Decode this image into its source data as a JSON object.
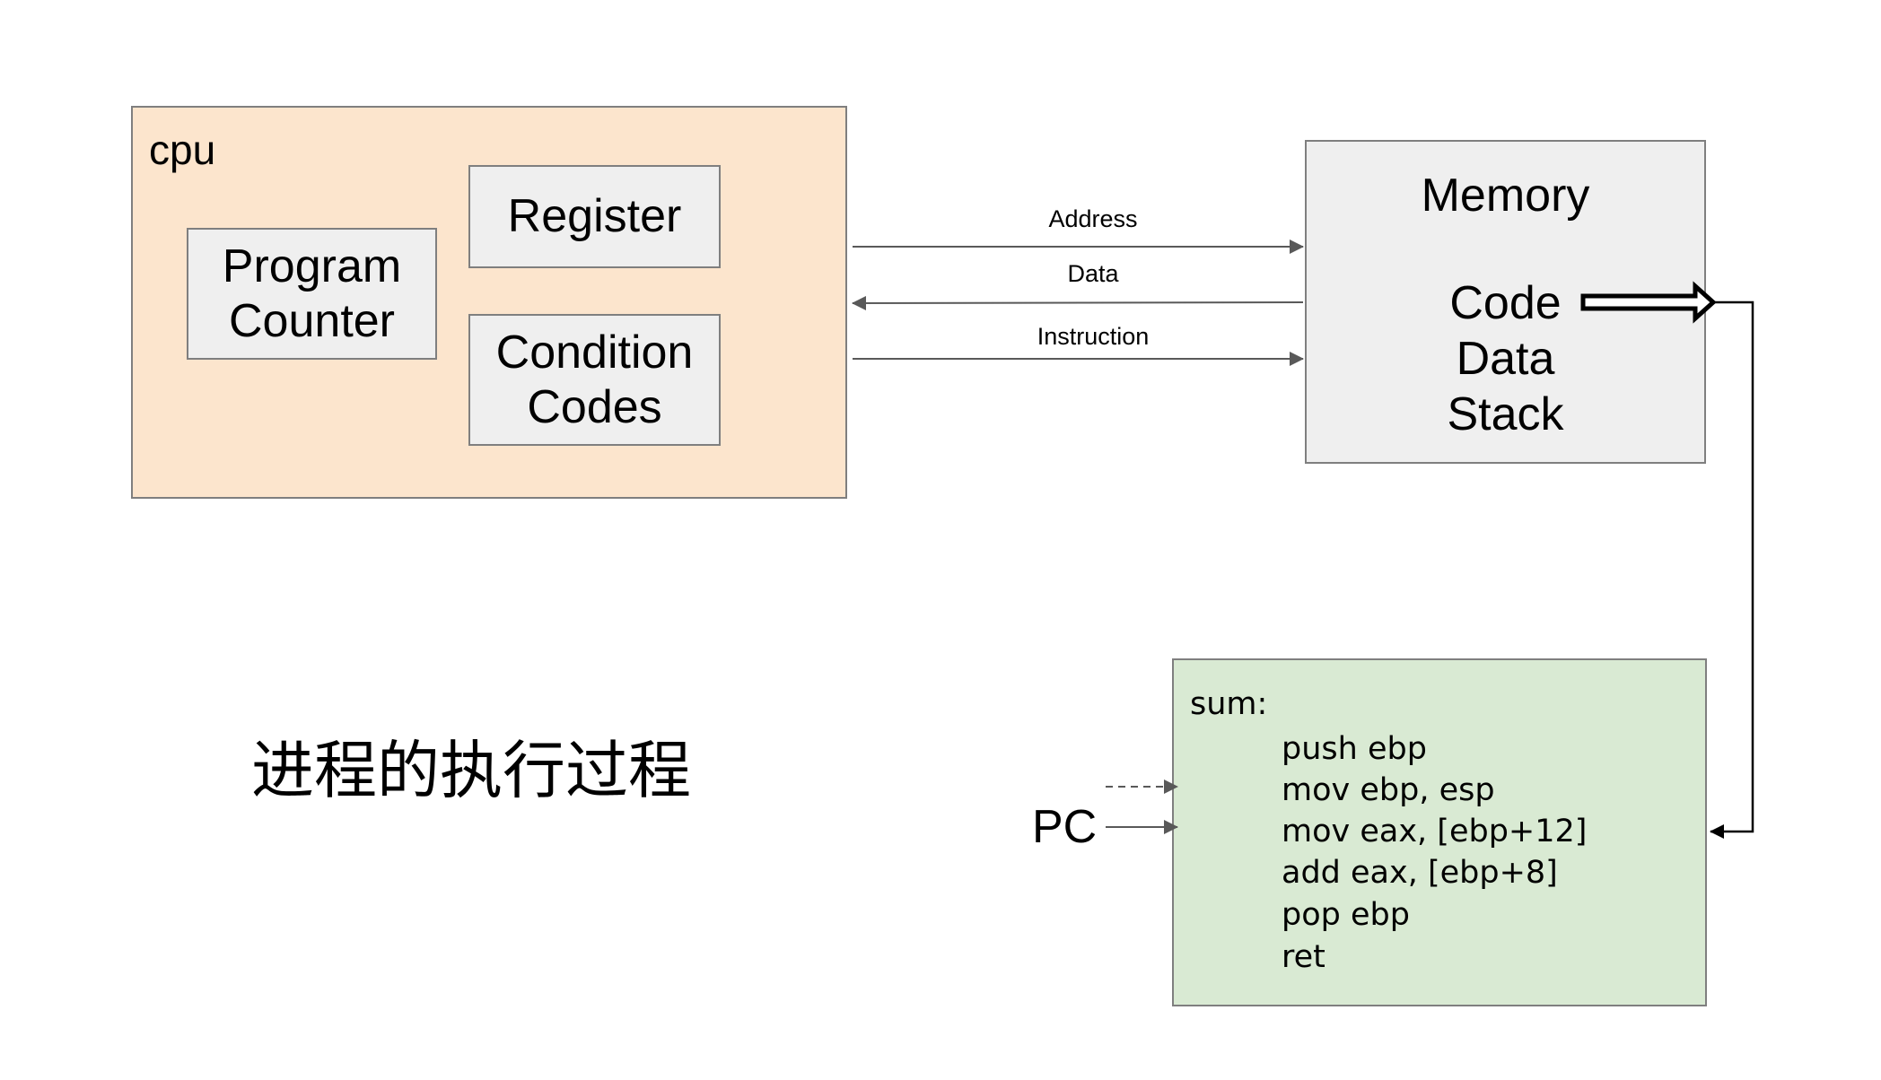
{
  "cpu": {
    "label": "cpu",
    "program_counter": "Program Counter",
    "register": "Register",
    "condition_codes": "Condition Codes"
  },
  "memory": {
    "title": "Memory",
    "segments": [
      "Code",
      "Data",
      "Stack"
    ]
  },
  "buses": {
    "address": "Address",
    "data": "Data",
    "instruction": "Instruction"
  },
  "code": {
    "title": "sum:",
    "lines": [
      "push ebp",
      "mov ebp, esp",
      "mov eax, [ebp+12]",
      "add eax, [ebp+8]",
      "pop ebp",
      "ret"
    ]
  },
  "pc_label": "PC",
  "caption": "进程的执行过程",
  "colors": {
    "cpu_fill": "#fce5cd",
    "inner_fill": "#efefef",
    "memory_fill": "#efefef",
    "code_fill": "#d9ead3",
    "border": "#7f7f7f",
    "arrow": "#595959"
  }
}
